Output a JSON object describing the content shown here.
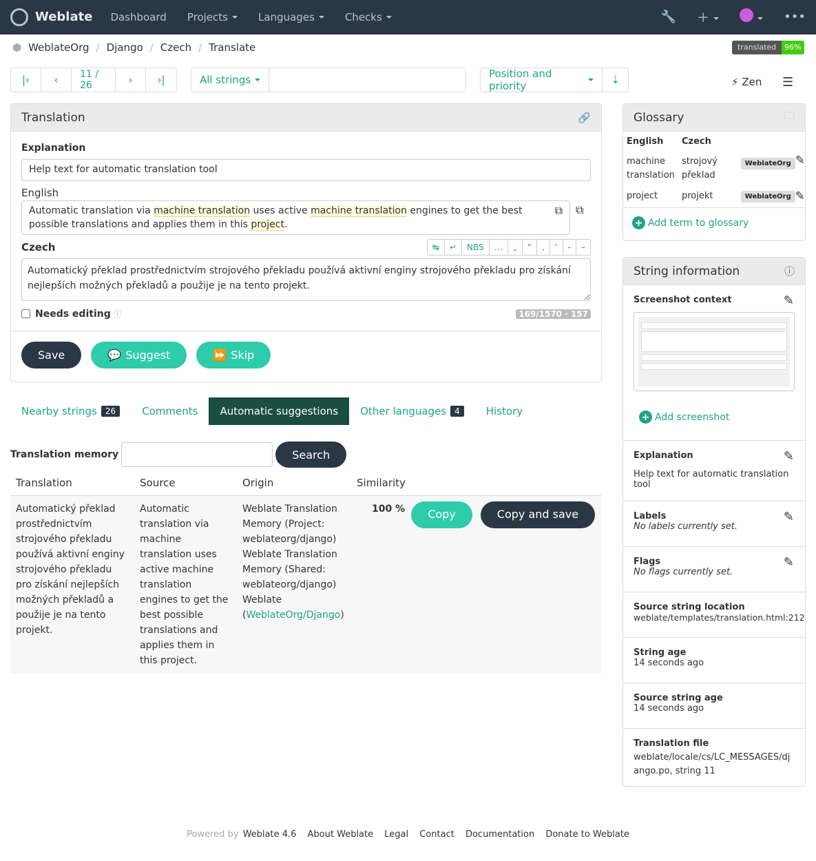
{
  "nav": {
    "brand": "Weblate",
    "items": [
      "Dashboard",
      "Projects",
      "Languages",
      "Checks"
    ]
  },
  "breadcrumb": [
    "WeblateOrg",
    "Django",
    "Czech",
    "Translate"
  ],
  "badge": {
    "label": "translated",
    "value": "96%"
  },
  "toolbar": {
    "position": "11 / 26",
    "filter": "All strings",
    "search_value": "",
    "sort": "Position and priority",
    "zen": "Zen"
  },
  "translation": {
    "title": "Translation",
    "explanation_label": "Explanation",
    "explanation": "Help text for automatic translation tool",
    "source_label": "English",
    "source_parts": [
      "Automatic translation via ",
      "machine translation",
      " uses active ",
      "machine translation",
      " engines to get the best possible translations and applies them in this ",
      "project",
      "."
    ],
    "target_label": "Czech",
    "special_chars": [
      "↹",
      "↵",
      "NBS",
      "…",
      "„",
      "“",
      "‚",
      "‘",
      "-",
      "–"
    ],
    "target": "Automatický překlad prostřednictvím strojového překladu používá aktivní enginy strojového překladu pro získání nejlepších možných překladů a použije je na tento projekt.",
    "needs_editing": "Needs editing",
    "counter": "169/1570 · 157",
    "save": "Save",
    "suggest": "Suggest",
    "skip": "Skip"
  },
  "tabs": [
    {
      "label": "Nearby strings",
      "count": "26"
    },
    {
      "label": "Comments"
    },
    {
      "label": "Automatic suggestions"
    },
    {
      "label": "Other languages",
      "count": "4"
    },
    {
      "label": "History"
    }
  ],
  "memory": {
    "label": "Translation memory",
    "value": "",
    "search": "Search",
    "headers": [
      "Translation",
      "Source",
      "Origin",
      "Similarity"
    ],
    "row": {
      "translation": "Automatický překlad prostřednictvím strojového překladu používá aktivní enginy strojového překladu pro získání nejlepších možných překladů a použije je na tento projekt.",
      "source": "Automatic translation via machine translation uses active machine translation engines to get the best possible translations and applies them in this project.",
      "origin": "Weblate Translation Memory (Project: weblateorg/django) Weblate Translation Memory (Shared: weblateorg/django) Weblate (",
      "origin_link": "WeblateOrg/Django",
      "origin_end": ")",
      "similarity": "100 %",
      "copy": "Copy",
      "copy_save": "Copy and save"
    }
  },
  "glossary": {
    "title": "Glossary",
    "headers": [
      "English",
      "Czech"
    ],
    "terms": [
      {
        "source": "machine translation",
        "target": "strojový překlad",
        "project": "WeblateOrg"
      },
      {
        "source": "project",
        "target": "projekt",
        "project": "WeblateOrg"
      }
    ],
    "add": "Add term to glossary"
  },
  "info": {
    "title": "String information",
    "screenshot_label": "Screenshot context",
    "add_screenshot": "Add screenshot",
    "items": [
      {
        "label": "Explanation",
        "value": "Help text for automatic translation tool"
      },
      {
        "label": "Labels",
        "value": "No labels currently set.",
        "italic": true
      },
      {
        "label": "Flags",
        "value": "No flags currently set.",
        "italic": true
      },
      {
        "label": "Source string location",
        "value": "weblate/templates/translation.html:212"
      },
      {
        "label": "String age",
        "value": "14 seconds ago"
      },
      {
        "label": "Source string age",
        "value": "14 seconds ago"
      },
      {
        "label": "Translation file",
        "value": "weblate/locale/cs/LC_MESSAGES/django.po, string 11"
      }
    ]
  },
  "footer": {
    "powered": "Powered by",
    "version": "Weblate 4.6",
    "links": [
      "About Weblate",
      "Legal",
      "Contact",
      "Documentation",
      "Donate to Weblate"
    ]
  }
}
